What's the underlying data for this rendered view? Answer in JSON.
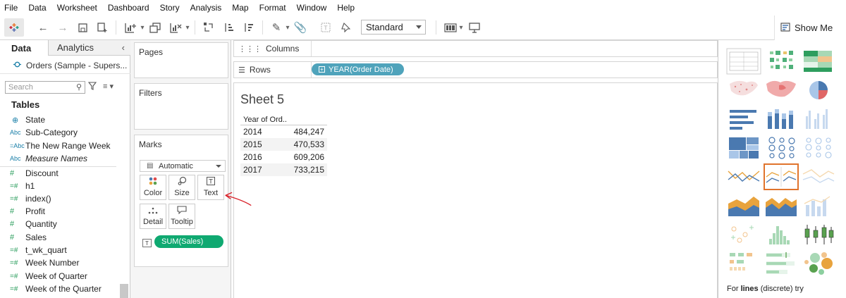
{
  "menu": [
    "File",
    "Data",
    "Worksheet",
    "Dashboard",
    "Story",
    "Analysis",
    "Map",
    "Format",
    "Window",
    "Help"
  ],
  "toolbar": {
    "fit_value": "Standard",
    "show_me_label": "Show Me"
  },
  "data_pane": {
    "tab_data": "Data",
    "tab_analytics": "Analytics",
    "data_source": "Orders (Sample - Supers...",
    "search_placeholder": "Search",
    "tables_heading": "Tables",
    "fields": [
      {
        "icon": "globe",
        "name": "State",
        "italic": false
      },
      {
        "icon": "Abc",
        "name": "Sub-Category",
        "italic": false
      },
      {
        "icon": "=Abc",
        "name": "The New Range Week",
        "italic": false
      },
      {
        "icon": "Abc",
        "name": "Measure Names",
        "italic": true
      },
      {
        "icon": "#",
        "name": "Discount",
        "italic": false
      },
      {
        "icon": "=#",
        "name": "h1",
        "italic": false
      },
      {
        "icon": "=#",
        "name": "index()",
        "italic": false
      },
      {
        "icon": "#",
        "name": "Profit",
        "italic": false
      },
      {
        "icon": "#",
        "name": "Quantity",
        "italic": false
      },
      {
        "icon": "#",
        "name": "Sales",
        "italic": false
      },
      {
        "icon": "=#",
        "name": "t_wk_quart",
        "italic": false
      },
      {
        "icon": "=#",
        "name": "Week Number",
        "italic": false
      },
      {
        "icon": "=#",
        "name": "Week of Quarter",
        "italic": false
      },
      {
        "icon": "=#",
        "name": "Week of the Quarter",
        "italic": false
      }
    ]
  },
  "shelves": {
    "pages": "Pages",
    "filters": "Filters",
    "marks": "Marks",
    "mark_type": "Automatic",
    "buttons": {
      "color": "Color",
      "size": "Size",
      "text": "Text",
      "detail": "Detail",
      "tooltip": "Tooltip"
    },
    "marks_pill": "SUM(Sales)",
    "columns": "Columns",
    "rows": "Rows",
    "rows_pill": "YEAR(Order Date)"
  },
  "sheet": {
    "title": "Sheet 5",
    "column_header": "Year of Ord..",
    "rows": [
      {
        "year": "2014",
        "value": "484,247"
      },
      {
        "year": "2015",
        "value": "470,533"
      },
      {
        "year": "2016",
        "value": "609,206"
      },
      {
        "year": "2017",
        "value": "733,215"
      }
    ]
  },
  "show_me": {
    "hint_prefix": "For ",
    "hint_bold": "lines",
    "hint_suffix": " (discrete) try",
    "selected_chart": "lines-discrete",
    "accent_color": "#e0742d"
  },
  "colors": {
    "dimension_pill": "#4fa3bb",
    "measure_pill": "#0fa971",
    "annotation": "#d9222a"
  }
}
